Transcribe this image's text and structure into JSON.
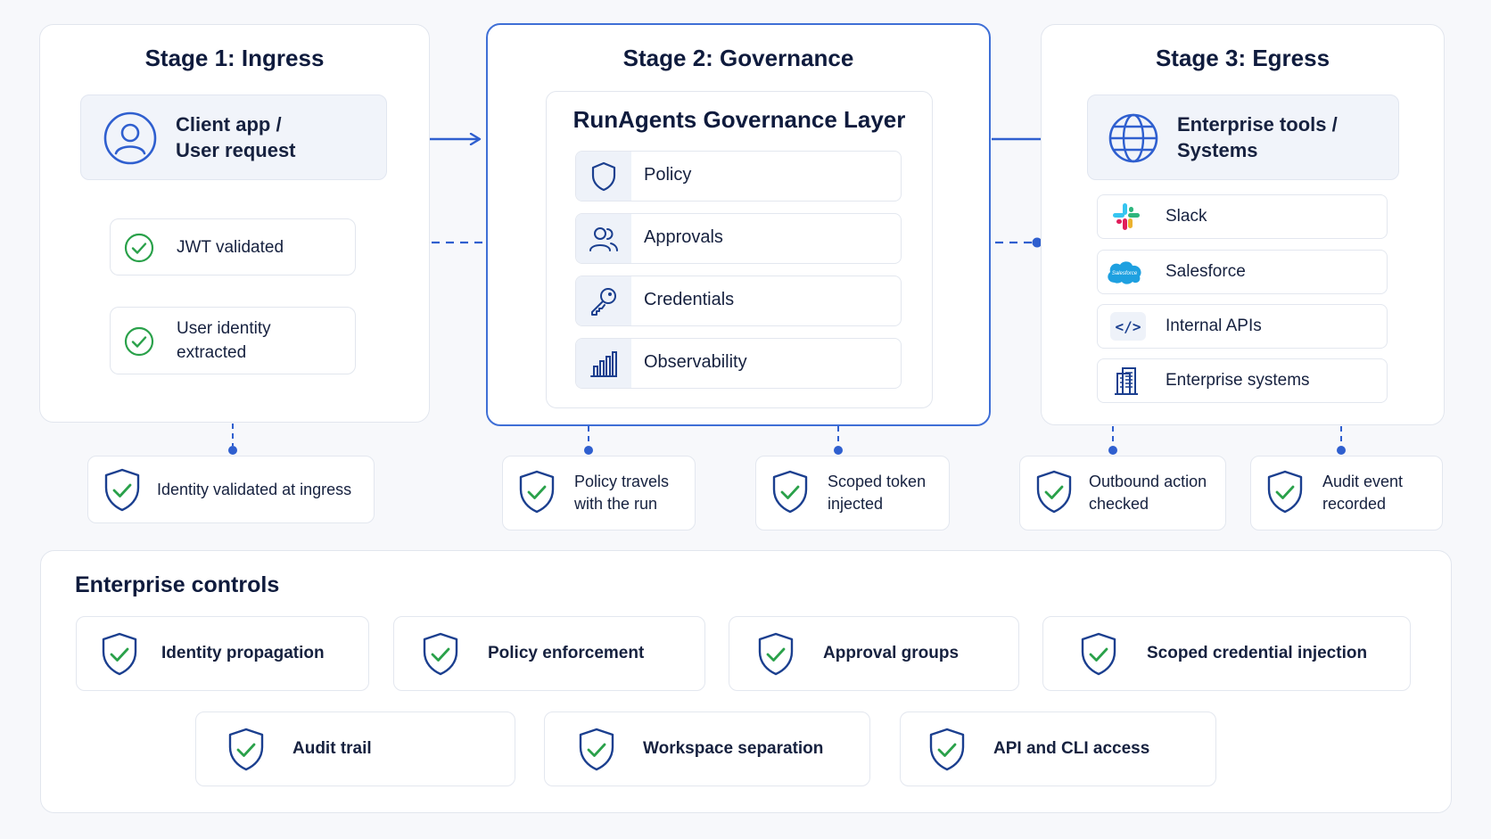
{
  "colors": {
    "accent": "#2f5fcf",
    "check": "#2aa14a",
    "navy": "#1b3f8f",
    "border": "#e2e6ee"
  },
  "stage1": {
    "title": "Stage 1: Ingress",
    "source_line1": "Client app /",
    "source_line2": "User request",
    "source_icon": "user-icon",
    "step1": "JWT validated",
    "step2_line1": "User identity",
    "step2_line2": "extracted"
  },
  "stage2": {
    "title": "Stage 2: Governance",
    "layer_title": "RunAgents Governance Layer",
    "items": [
      {
        "label": "Policy",
        "icon": "shield-icon"
      },
      {
        "label": "Approvals",
        "icon": "users-icon"
      },
      {
        "label": "Credentials",
        "icon": "key-icon"
      },
      {
        "label": "Observability",
        "icon": "bar-chart-icon"
      }
    ]
  },
  "stage3": {
    "title": "Stage 3: Egress",
    "target_line1": "Enterprise tools /",
    "target_line2": "Systems",
    "target_icon": "globe-icon",
    "tools": [
      {
        "label": "Slack",
        "icon": "slack-icon"
      },
      {
        "label": "Salesforce",
        "icon": "salesforce-icon",
        "logo_text": "Salesforce"
      },
      {
        "label": "Internal APIs",
        "icon": "code-icon",
        "icon_text": "</>"
      },
      {
        "label": "Enterprise systems",
        "icon": "building-icon"
      }
    ]
  },
  "checkpoints": [
    {
      "line1": "Identity validated at ingress",
      "line2": ""
    },
    {
      "line1": "Policy travels",
      "line2": "with the run"
    },
    {
      "line1": "Scoped token",
      "line2": "injected"
    },
    {
      "line1": "Outbound action",
      "line2": "checked"
    },
    {
      "line1": "Audit event",
      "line2": "recorded"
    }
  ],
  "controls": {
    "title": "Enterprise controls",
    "row1": [
      "Identity propagation",
      "Policy enforcement",
      "Approval groups",
      "Scoped credential injection"
    ],
    "row2": [
      "Audit trail",
      "Workspace separation",
      "API and CLI access"
    ]
  }
}
